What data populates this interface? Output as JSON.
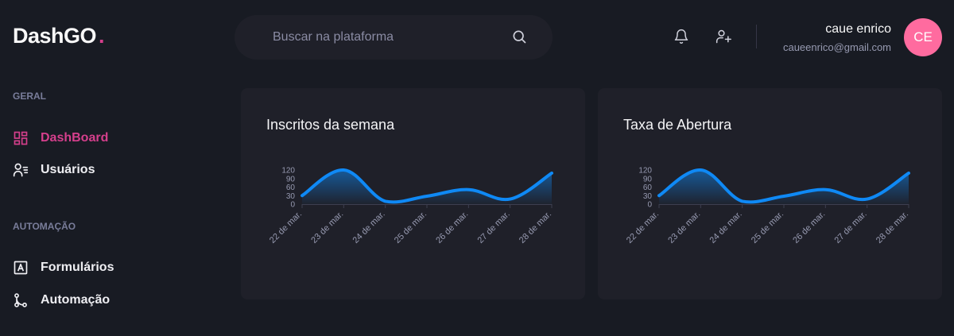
{
  "logo": {
    "text": "DashGO",
    "dot": "."
  },
  "search": {
    "placeholder": "Buscar na plataforma"
  },
  "header": {
    "icons": [
      "bell-icon",
      "user-add-icon"
    ],
    "user": {
      "name": "caue enrico",
      "email": "caueenrico@gmail.com",
      "initials": "CE"
    }
  },
  "sidebar": {
    "sections": [
      {
        "title": "GERAL",
        "items": [
          {
            "label": "DashBoard",
            "icon": "dashboard-icon",
            "active": true
          },
          {
            "label": "Usuários",
            "icon": "users-icon",
            "active": false
          }
        ]
      },
      {
        "title": "AUTOMAÇÃO",
        "items": [
          {
            "label": "Formulários",
            "icon": "form-icon",
            "active": false
          },
          {
            "label": "Automação",
            "icon": "git-merge-icon",
            "active": false
          }
        ]
      }
    ]
  },
  "colors": {
    "accent": "#d53f8c",
    "line": "#0f89f5",
    "avatar": "#ff6b9f",
    "background": "#181b23",
    "card": "#1f2029"
  },
  "chart_data": [
    {
      "type": "area",
      "title": "Inscritos da semana",
      "categories": [
        "22 de mar.",
        "23 de mar.",
        "24 de mar.",
        "25 de mar.",
        "26 de mar.",
        "27 de mar.",
        "28 de mar."
      ],
      "values": [
        30,
        120,
        10,
        28,
        51,
        18,
        109
      ],
      "yticks": [
        0,
        30,
        60,
        90,
        120
      ],
      "ylim": [
        0,
        120
      ],
      "grid": false
    },
    {
      "type": "area",
      "title": "Taxa de Abertura",
      "categories": [
        "22 de mar.",
        "23 de mar.",
        "24 de mar.",
        "25 de mar.",
        "26 de mar.",
        "27 de mar.",
        "28 de mar."
      ],
      "values": [
        30,
        120,
        10,
        28,
        51,
        18,
        109
      ],
      "yticks": [
        0,
        30,
        60,
        90,
        120
      ],
      "ylim": [
        0,
        120
      ],
      "grid": false
    }
  ]
}
